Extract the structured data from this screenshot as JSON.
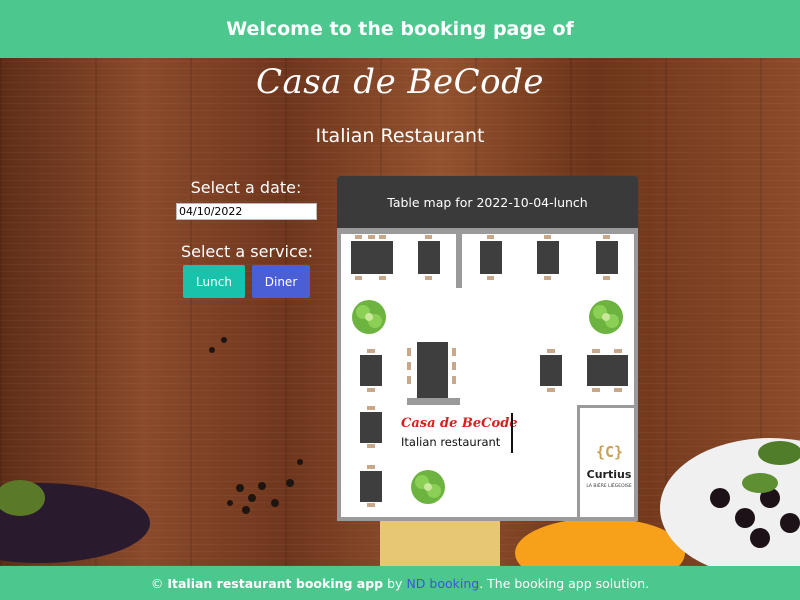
{
  "header": {
    "welcome": "Welcome to the booking page of",
    "restaurant_name": "Casa de BeCode",
    "restaurant_type": "Italian Restaurant"
  },
  "booking_form": {
    "date_label": "Select a date:",
    "date_value": "04/10/2022",
    "service_label": "Select a service:",
    "lunch_label": "Lunch",
    "diner_label": "Diner"
  },
  "table_map": {
    "title": "Table map for 2022-10-04-lunch",
    "logo_name": "Casa de BeCode",
    "logo_subtitle": "Italian restaurant",
    "neighbor_icon": "{C}",
    "neighbor_name": "Curtius",
    "neighbor_subtitle": "LA BIÈRE LIÉGEOISE"
  },
  "footer": {
    "copyright_symbol": "©",
    "app_name": "Italian restaurant booking app",
    "by": "by",
    "brand": "ND booking",
    "tagline": ". The booking app solution."
  },
  "colors": {
    "accent_green": "#4cc78e",
    "lunch_button": "#19c3ab",
    "diner_button": "#4a5fd6",
    "map_header": "#3a3a3a",
    "logo_red": "#d62020",
    "brand_blue": "#3b57d6"
  }
}
